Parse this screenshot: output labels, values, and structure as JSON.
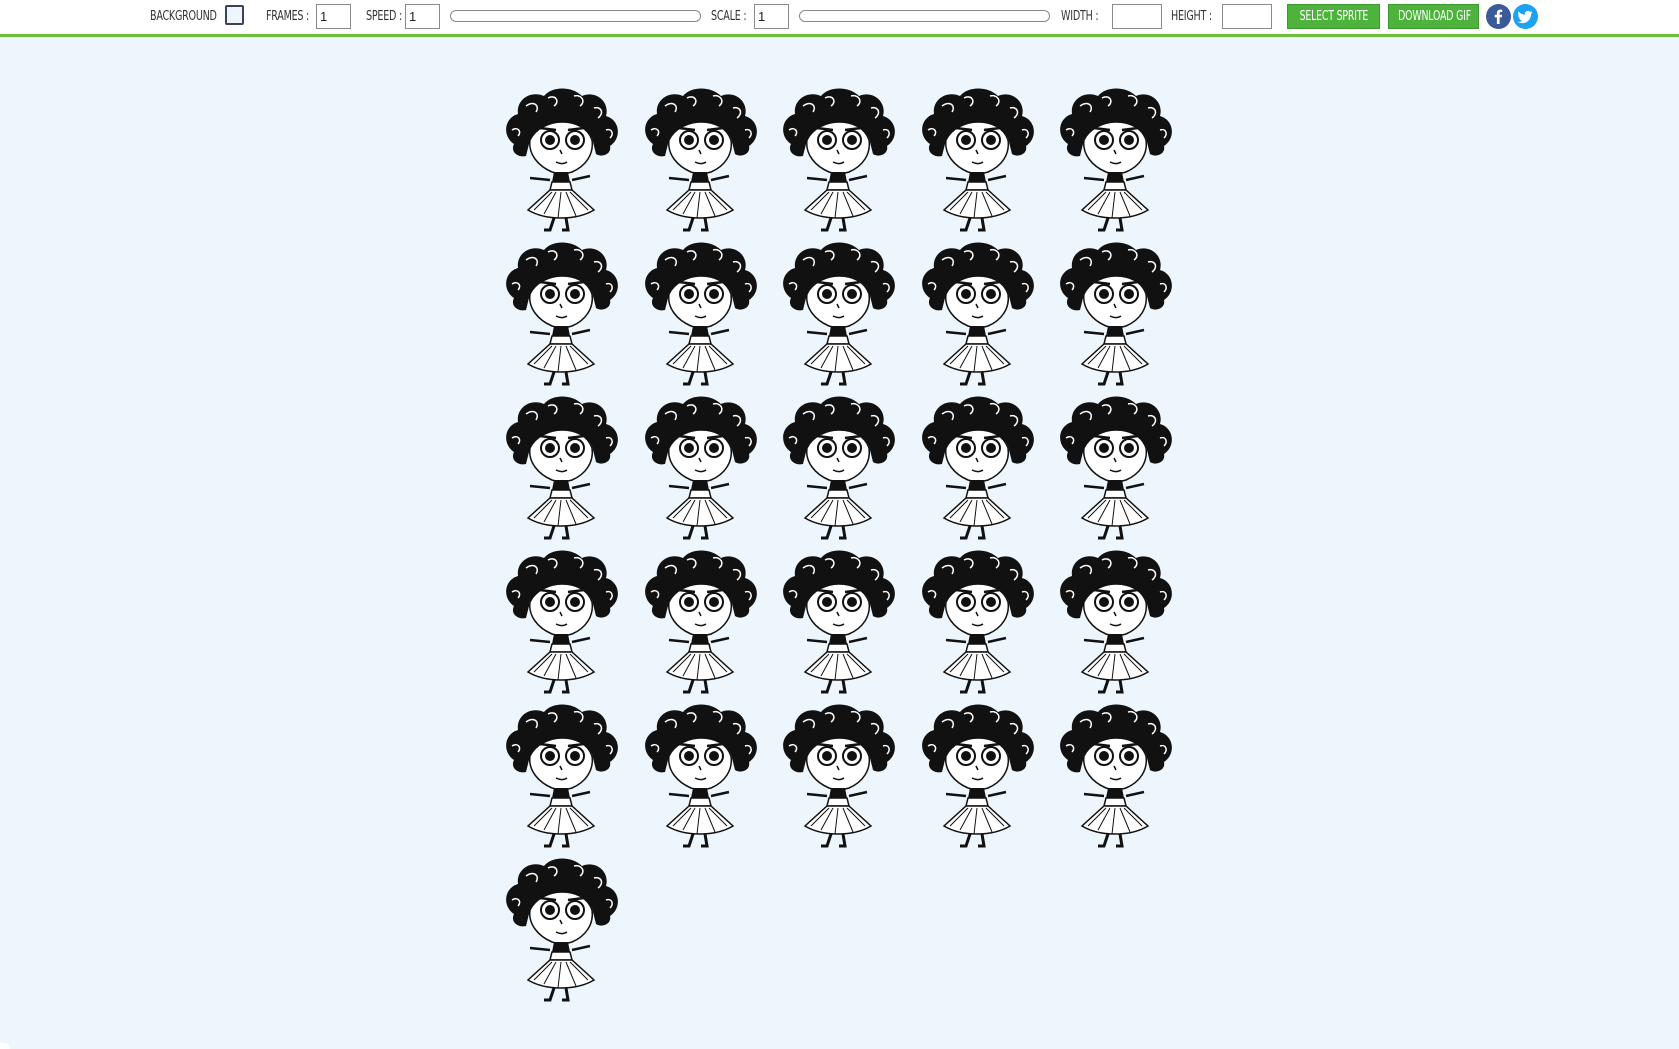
{
  "toolbar": {
    "background_label": "BACKGROUND",
    "frames_label": "FRAMES :",
    "frames_value": "1",
    "speed_label": "SPEED :",
    "speed_value": "1",
    "scale_label": "SCALE :",
    "scale_value": "1",
    "width_label": "WIDTH :",
    "width_value": "",
    "height_label": "HEIGHT :",
    "height_value": "",
    "select_sprite_label": "SELECT SPRITE",
    "download_gif_label": "DOWNLOAD GIF",
    "facebook_icon": "facebook-icon",
    "twitter_icon": "twitter-icon",
    "accent_color": "#6cbd3a",
    "button_color": "#4db33d"
  },
  "sprite_sheet": {
    "frame_count": 26,
    "background_color": "#eef6fd"
  }
}
